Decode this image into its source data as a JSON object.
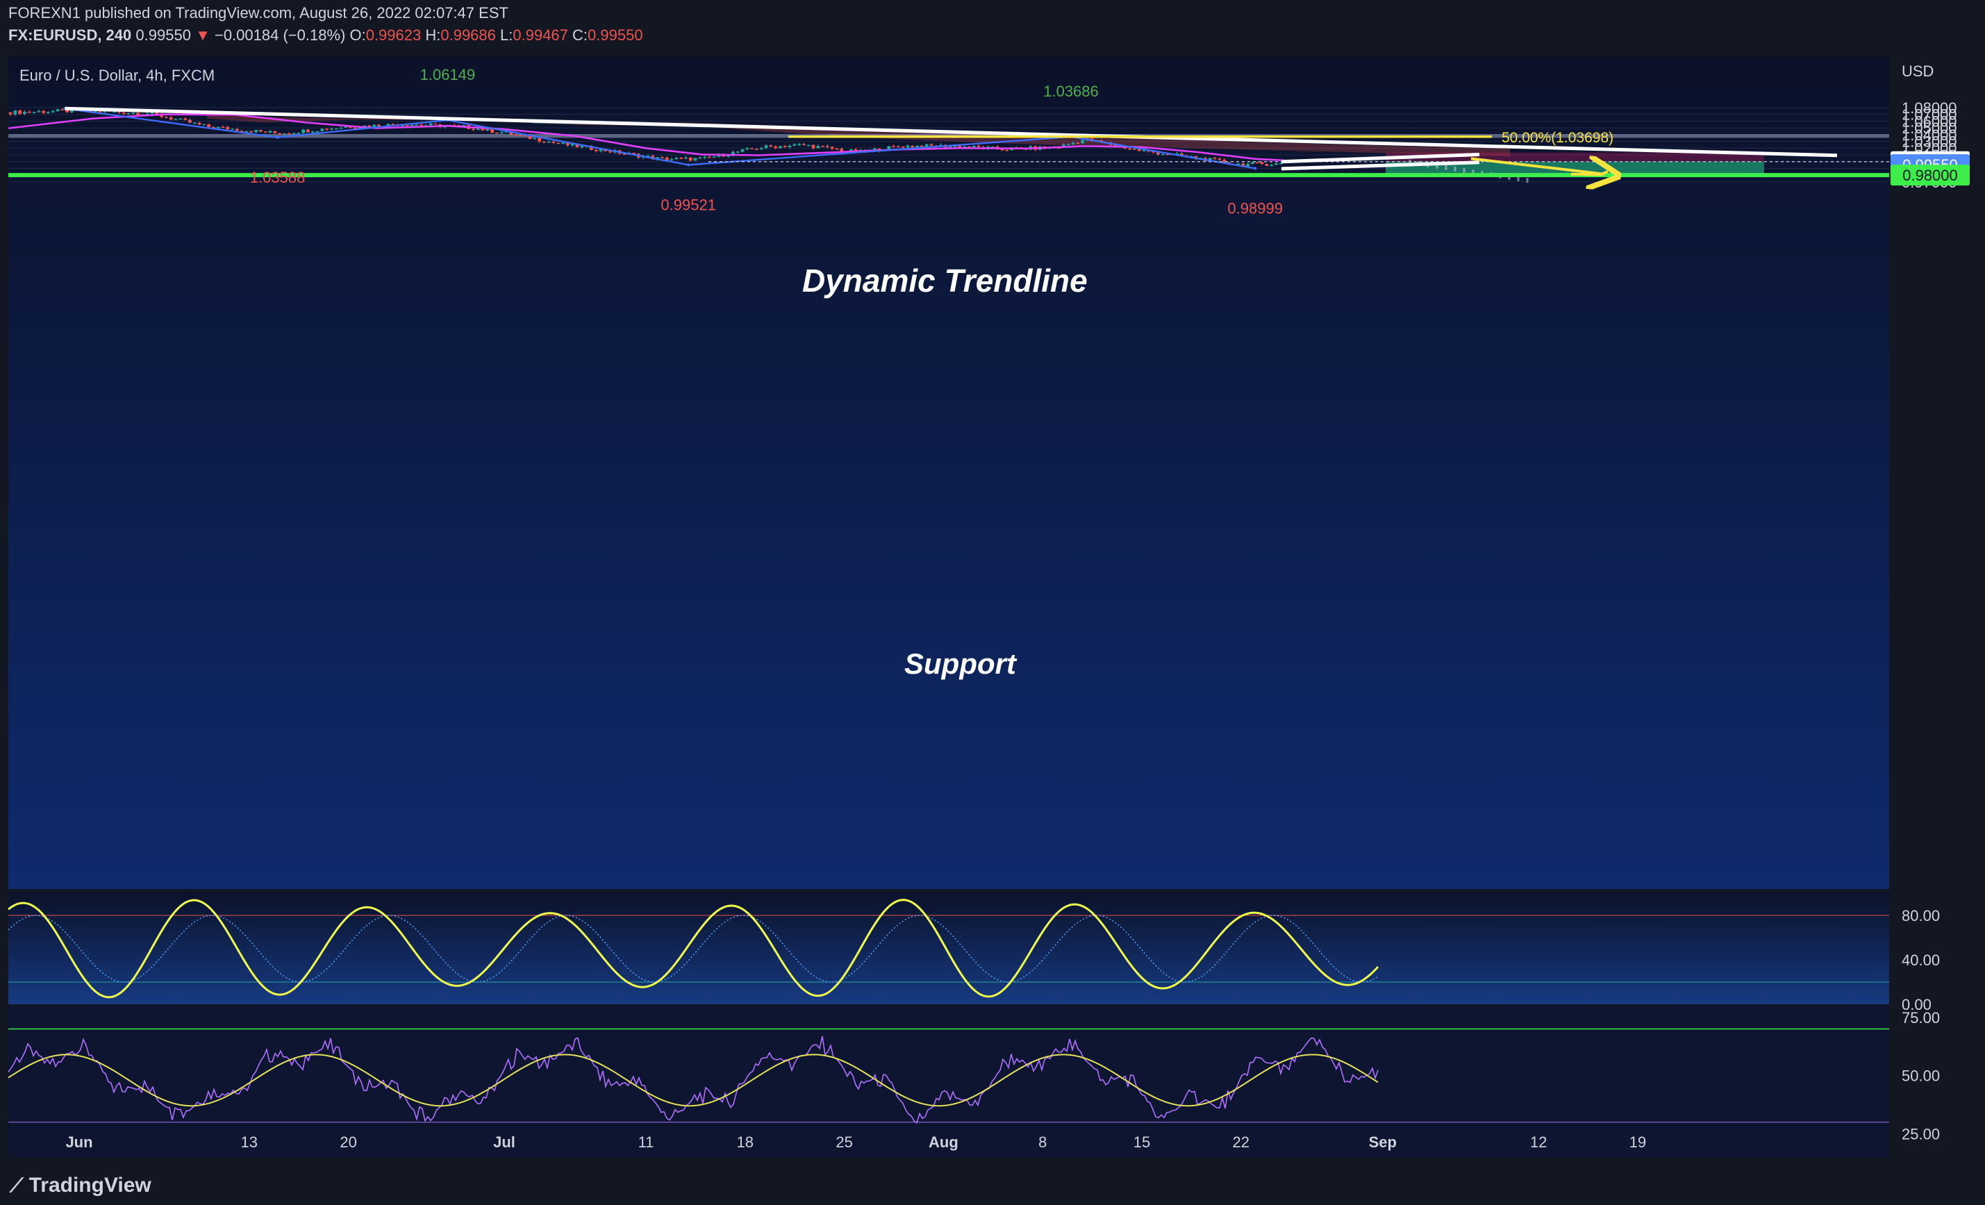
{
  "header": {
    "publish_line": "FOREXN1 published on TradingView.com, August 26, 2022 02:07:47 EST",
    "symbol": "FX:EURUSD, 240",
    "last": "0.99550",
    "change": "−0.00184 (−0.18%)",
    "open_label": "O:",
    "open": "0.99623",
    "high_label": "H:",
    "high": "0.99686",
    "low_label": "L:",
    "low": "0.99467",
    "close_label": "C:",
    "close": "0.99550"
  },
  "chart_title": "Euro / U.S. Dollar, 4h, FXCM",
  "footer": {
    "brand": "TradingView"
  },
  "colors": {
    "bg_top": "#0b1128",
    "bg_bottom": "#0f2a6e",
    "bull": "#26a69a",
    "bear": "#ef5350",
    "ma": "#e040fb",
    "zigzag": "#3d6cff",
    "trend": "#ffffff",
    "fib": "#f5e33f",
    "support_green": "#3dee4b",
    "stoch": "#f0ff4a",
    "rsi": "#b070ff"
  },
  "chart_data": {
    "type": "line",
    "price_unit": "USD",
    "price_axis": {
      "ticks": [
        "1.08000",
        "1.07000",
        "1.06000",
        "1.05000",
        "1.04000",
        "1.03000",
        "1.02000",
        "1.01000",
        "1.00000",
        "0.99000",
        "0.98000",
        "0.97000"
      ],
      "range": [
        0.9665,
        1.083
      ]
    },
    "x_ticks": [
      "Jun",
      "13",
      "20",
      "Jul",
      "11",
      "18",
      "25",
      "Aug",
      "8",
      "15",
      "22",
      "Sep",
      "12",
      "19"
    ],
    "price_badges": [
      {
        "value": "1.00000",
        "style": "white"
      },
      {
        "value": "0.99550",
        "style": "blue"
      },
      {
        "value": "0.98000",
        "style": "green"
      }
    ],
    "annotations": {
      "trendline_label": "Dynamic Trendline",
      "support_label": "Support",
      "fib_label": "50.00%(1.03698)",
      "swing_labels": [
        {
          "text": "1.06149",
          "price": 1.0615,
          "kind": "high"
        },
        {
          "text": "1.03588",
          "price": 1.0359,
          "kind": "low"
        },
        {
          "text": "1.03686",
          "price": 1.0369,
          "kind": "high"
        },
        {
          "text": "0.99521",
          "price": 0.9952,
          "kind": "low"
        },
        {
          "text": "0.98999",
          "price": 0.99,
          "kind": "low"
        }
      ],
      "resistance_zone": [
        1.0353,
        1.0408
      ],
      "support_level": 0.98,
      "fib_level": 1.03698,
      "trade_box": {
        "entry": 1.0,
        "stop": 1.0135,
        "target": 0.98
      }
    },
    "zigzag": [
      {
        "x": "May 31",
        "price": 1.0787
      },
      {
        "x": "Jun 15",
        "price": 1.0359
      },
      {
        "x": "Jun 27",
        "price": 1.0615
      },
      {
        "x": "Jul 14",
        "price": 0.9952
      },
      {
        "x": "Aug 10",
        "price": 1.0369
      },
      {
        "x": "Aug 23",
        "price": 0.99
      }
    ],
    "series": [
      {
        "name": "EURUSD close (approx.)",
        "x": [
          "May 27",
          "Jun 1",
          "Jun 6",
          "Jun 10",
          "Jun 15",
          "Jun 20",
          "Jun 24",
          "Jun 28",
          "Jul 1",
          "Jul 5",
          "Jul 8",
          "Jul 12",
          "Jul 15",
          "Jul 19",
          "Jul 22",
          "Jul 26",
          "Jul 29",
          "Aug 2",
          "Aug 5",
          "Aug 9",
          "Aug 11",
          "Aug 15",
          "Aug 18",
          "Aug 22",
          "Aug 25"
        ],
        "values": [
          1.073,
          1.0755,
          1.0715,
          1.052,
          1.042,
          1.052,
          1.0555,
          1.052,
          1.043,
          1.026,
          1.017,
          1.004,
          1.004,
          1.021,
          1.025,
          1.014,
          1.023,
          1.023,
          1.0185,
          1.021,
          1.033,
          1.016,
          1.008,
          0.996,
          0.997
        ]
      }
    ],
    "oscillators": [
      {
        "name": "stochastic",
        "ticks": [
          "80.00",
          "40.00",
          "0.00"
        ],
        "range": [
          0,
          100
        ]
      },
      {
        "name": "rsi",
        "ticks": [
          "75.00",
          "50.00",
          "25.00"
        ],
        "range": [
          15,
          80
        ]
      }
    ]
  }
}
